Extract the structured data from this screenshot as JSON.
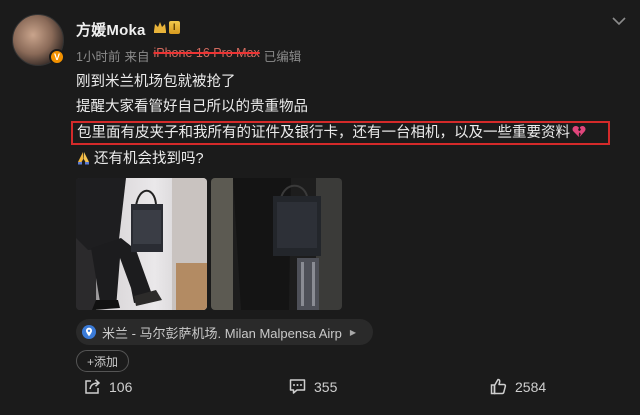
{
  "user": {
    "name": "方媛Moka",
    "level": "I",
    "verified_badge": "V"
  },
  "meta": {
    "time": "1小时前",
    "from_prefix": "来自",
    "device": "iPhone 16 Pro Max",
    "edited": "已编辑"
  },
  "post": {
    "lines": [
      "刚到米兰机场包就被抢了",
      "提醒大家看管好自己所以的贵重物品",
      "包里面有皮夹子和我所有的证件及银行卡，还有一台相机，以及一些重要资料",
      "还有机会找到吗?"
    ],
    "highlight_color": "#d42a2a"
  },
  "location": {
    "text": "米兰 - 马尔彭萨机场. Milan Malpensa Airp"
  },
  "add_tag": {
    "label": "+添加"
  },
  "actions": {
    "share_count": "106",
    "comment_count": "355",
    "like_count": "2584"
  },
  "icons": {
    "broken_heart": "broken-heart-icon",
    "pray": "pray-icon",
    "pin": "pin-icon",
    "share": "share-icon",
    "comment": "comment-icon",
    "like": "thumbs-up-icon",
    "menu": "chevron-down-icon"
  }
}
